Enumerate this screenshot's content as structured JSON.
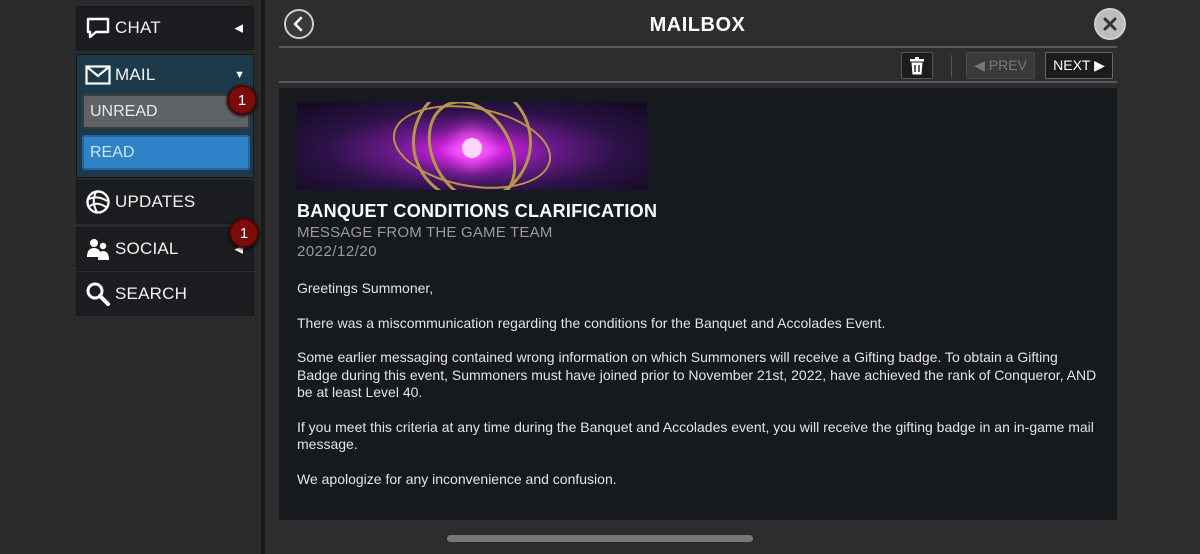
{
  "header": {
    "title": "MAILBOX"
  },
  "sidebar": {
    "chat": {
      "label": "CHAT"
    },
    "mail": {
      "label": "MAIL",
      "unread_label": "UNREAD",
      "read_label": "READ",
      "unread_badge": "1"
    },
    "updates": {
      "label": "UPDATES"
    },
    "social": {
      "label": "SOCIAL",
      "badge": "1"
    },
    "search": {
      "label": "SEARCH"
    }
  },
  "toolbar": {
    "prev_label": "◀ PREV",
    "next_label": "NEXT ▶"
  },
  "message": {
    "title": "BANQUET CONDITIONS CLARIFICATION",
    "subtitle": "MESSAGE FROM THE GAME TEAM",
    "date": "2022/12/20",
    "paragraphs": [
      "Greetings Summoner,",
      "There was a miscommunication regarding the conditions for the Banquet and Accolades Event.",
      "Some earlier messaging contained wrong information on which Summoners will receive a Gifting badge. To obtain a Gifting Badge during this event, Summoners must have joined prior to November 21st, 2022, have achieved the rank of Conqueror, AND be at least Level 40.",
      "If you meet this criteria at any time during the Banquet and Accolades event, you will receive the gifting badge in an in-game mail message.",
      "We apologize for any inconvenience and confusion."
    ]
  },
  "colors": {
    "selected": "#2f82c7",
    "mail_group": "#1c3a4a",
    "badge": "#7a0c0c"
  }
}
